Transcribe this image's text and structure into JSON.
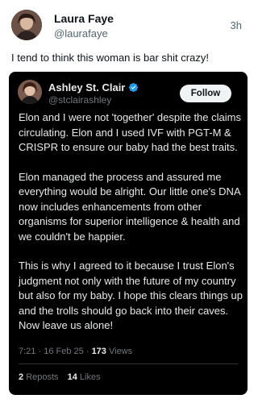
{
  "outer_tweet": {
    "author_name": "Laura Faye",
    "author_handle": "@laurafaye",
    "time": "3h",
    "text": "I tend to think this woman is bar shit crazy!"
  },
  "quoted_tweet": {
    "author_name": "Ashley St. Clair",
    "author_handle": "@stclairashley",
    "follow_label": "Follow",
    "verified_icon": "verified-badge-icon",
    "verified_color": "#1d9bf0",
    "paragraphs": [
      "Elon and I were not 'together' despite the claims circulating. Elon and I used IVF with PGT-M & CRISPR to ensure our baby had the best traits.",
      "Elon managed the process and assured me everything would be alright. Our little one's DNA now includes enhancements from other organisms for superior intelligence & health and we couldn't be happier.",
      "This is why I agreed to it because I trust Elon's judgment not only with the future of my country but also for my baby. I hope this clears things up and the trolls should go back into their caves. Now leave us alone!"
    ],
    "time": "7:21",
    "date": "16 Feb 25",
    "views_count": "173",
    "views_label": "Views",
    "reposts_count": "2",
    "reposts_label": "Reposts",
    "likes_count": "14",
    "likes_label": "Likes"
  }
}
